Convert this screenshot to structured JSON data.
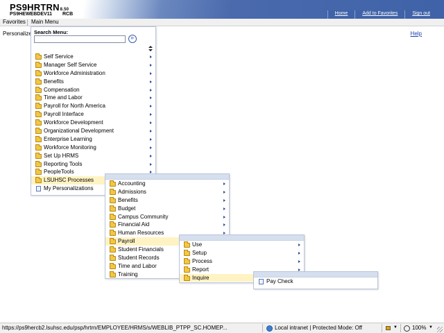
{
  "header": {
    "app_title": "PS9HRTRN",
    "app_version": "8.50",
    "database": "PS9HEWEBDEV11",
    "user": "RCB",
    "nav": [
      "Home",
      "Add to Favorites",
      "Sign out"
    ]
  },
  "menubar": {
    "favorites": "Favorites",
    "main_menu": "Main Menu"
  },
  "page": {
    "personalize": "Personalize",
    "help": "Help"
  },
  "search": {
    "label": "Search Menu:",
    "value": ""
  },
  "main_menu": {
    "items": [
      {
        "label": "Self Service",
        "submenu": true
      },
      {
        "label": "Manager Self Service",
        "submenu": true
      },
      {
        "label": "Workforce Administration",
        "submenu": true
      },
      {
        "label": "Benefits",
        "submenu": true
      },
      {
        "label": "Compensation",
        "submenu": true
      },
      {
        "label": "Time and Labor",
        "submenu": true
      },
      {
        "label": "Payroll for North America",
        "submenu": true
      },
      {
        "label": "Payroll Interface",
        "submenu": true
      },
      {
        "label": "Workforce Development",
        "submenu": true
      },
      {
        "label": "Organizational Development",
        "submenu": true
      },
      {
        "label": "Enterprise Learning",
        "submenu": true
      },
      {
        "label": "Workforce Monitoring",
        "submenu": true
      },
      {
        "label": "Set Up HRMS",
        "submenu": true
      },
      {
        "label": "Reporting Tools",
        "submenu": true
      },
      {
        "label": "PeopleTools",
        "submenu": true
      },
      {
        "label": "LSUHSC Processes",
        "submenu": true,
        "active": true
      },
      {
        "label": "My Personalizations",
        "submenu": false,
        "page": true
      }
    ]
  },
  "lsuhsc_menu": {
    "items": [
      {
        "label": "Accounting",
        "submenu": true
      },
      {
        "label": "Admissions",
        "submenu": true
      },
      {
        "label": "Benefits",
        "submenu": true
      },
      {
        "label": "Budget",
        "submenu": true
      },
      {
        "label": "Campus Community",
        "submenu": true
      },
      {
        "label": "Financial Aid",
        "submenu": true
      },
      {
        "label": "Human Resources",
        "submenu": true
      },
      {
        "label": "Payroll",
        "submenu": true,
        "active": true
      },
      {
        "label": "Student Financials",
        "submenu": true
      },
      {
        "label": "Student Records",
        "submenu": true
      },
      {
        "label": "Time and Labor",
        "submenu": true
      },
      {
        "label": "Training",
        "submenu": true
      }
    ]
  },
  "payroll_menu": {
    "items": [
      {
        "label": "Use",
        "submenu": true
      },
      {
        "label": "Setup",
        "submenu": true
      },
      {
        "label": "Process",
        "submenu": true
      },
      {
        "label": "Report",
        "submenu": true
      },
      {
        "label": "Inquire",
        "submenu": true,
        "active": true
      }
    ]
  },
  "inquire_menu": {
    "items": [
      {
        "label": "Pay Check",
        "submenu": false,
        "page": true
      }
    ]
  },
  "status": {
    "url": "https://ps9hercb2.lsuhsc.edu/psp/hrtrn/EMPLOYEE/HRMS/s/WEBLIB_PTPP_SC.HOMEP...",
    "zone": "Local intranet | Protected Mode: Off",
    "zoom": "100%"
  },
  "colors": {
    "accent": "#3f62a8",
    "highlight": "#fff3c4",
    "folder": "#f2c646"
  }
}
